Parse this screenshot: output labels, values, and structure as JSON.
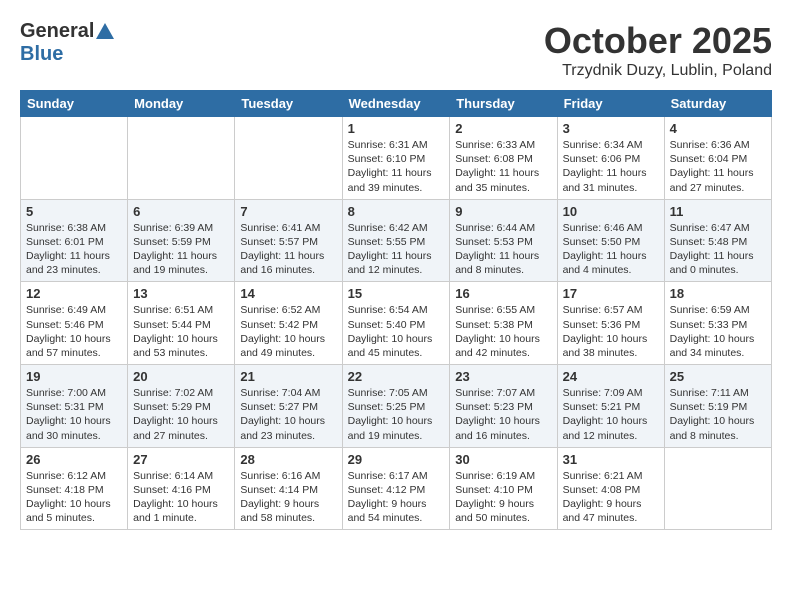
{
  "header": {
    "logo_general": "General",
    "logo_blue": "Blue",
    "month_title": "October 2025",
    "location": "Trzydnik Duzy, Lublin, Poland"
  },
  "days_of_week": [
    "Sunday",
    "Monday",
    "Tuesday",
    "Wednesday",
    "Thursday",
    "Friday",
    "Saturday"
  ],
  "weeks": [
    [
      {
        "day": "",
        "info": ""
      },
      {
        "day": "",
        "info": ""
      },
      {
        "day": "",
        "info": ""
      },
      {
        "day": "1",
        "info": "Sunrise: 6:31 AM\nSunset: 6:10 PM\nDaylight: 11 hours\nand 39 minutes."
      },
      {
        "day": "2",
        "info": "Sunrise: 6:33 AM\nSunset: 6:08 PM\nDaylight: 11 hours\nand 35 minutes."
      },
      {
        "day": "3",
        "info": "Sunrise: 6:34 AM\nSunset: 6:06 PM\nDaylight: 11 hours\nand 31 minutes."
      },
      {
        "day": "4",
        "info": "Sunrise: 6:36 AM\nSunset: 6:04 PM\nDaylight: 11 hours\nand 27 minutes."
      }
    ],
    [
      {
        "day": "5",
        "info": "Sunrise: 6:38 AM\nSunset: 6:01 PM\nDaylight: 11 hours\nand 23 minutes."
      },
      {
        "day": "6",
        "info": "Sunrise: 6:39 AM\nSunset: 5:59 PM\nDaylight: 11 hours\nand 19 minutes."
      },
      {
        "day": "7",
        "info": "Sunrise: 6:41 AM\nSunset: 5:57 PM\nDaylight: 11 hours\nand 16 minutes."
      },
      {
        "day": "8",
        "info": "Sunrise: 6:42 AM\nSunset: 5:55 PM\nDaylight: 11 hours\nand 12 minutes."
      },
      {
        "day": "9",
        "info": "Sunrise: 6:44 AM\nSunset: 5:53 PM\nDaylight: 11 hours\nand 8 minutes."
      },
      {
        "day": "10",
        "info": "Sunrise: 6:46 AM\nSunset: 5:50 PM\nDaylight: 11 hours\nand 4 minutes."
      },
      {
        "day": "11",
        "info": "Sunrise: 6:47 AM\nSunset: 5:48 PM\nDaylight: 11 hours\nand 0 minutes."
      }
    ],
    [
      {
        "day": "12",
        "info": "Sunrise: 6:49 AM\nSunset: 5:46 PM\nDaylight: 10 hours\nand 57 minutes."
      },
      {
        "day": "13",
        "info": "Sunrise: 6:51 AM\nSunset: 5:44 PM\nDaylight: 10 hours\nand 53 minutes."
      },
      {
        "day": "14",
        "info": "Sunrise: 6:52 AM\nSunset: 5:42 PM\nDaylight: 10 hours\nand 49 minutes."
      },
      {
        "day": "15",
        "info": "Sunrise: 6:54 AM\nSunset: 5:40 PM\nDaylight: 10 hours\nand 45 minutes."
      },
      {
        "day": "16",
        "info": "Sunrise: 6:55 AM\nSunset: 5:38 PM\nDaylight: 10 hours\nand 42 minutes."
      },
      {
        "day": "17",
        "info": "Sunrise: 6:57 AM\nSunset: 5:36 PM\nDaylight: 10 hours\nand 38 minutes."
      },
      {
        "day": "18",
        "info": "Sunrise: 6:59 AM\nSunset: 5:33 PM\nDaylight: 10 hours\nand 34 minutes."
      }
    ],
    [
      {
        "day": "19",
        "info": "Sunrise: 7:00 AM\nSunset: 5:31 PM\nDaylight: 10 hours\nand 30 minutes."
      },
      {
        "day": "20",
        "info": "Sunrise: 7:02 AM\nSunset: 5:29 PM\nDaylight: 10 hours\nand 27 minutes."
      },
      {
        "day": "21",
        "info": "Sunrise: 7:04 AM\nSunset: 5:27 PM\nDaylight: 10 hours\nand 23 minutes."
      },
      {
        "day": "22",
        "info": "Sunrise: 7:05 AM\nSunset: 5:25 PM\nDaylight: 10 hours\nand 19 minutes."
      },
      {
        "day": "23",
        "info": "Sunrise: 7:07 AM\nSunset: 5:23 PM\nDaylight: 10 hours\nand 16 minutes."
      },
      {
        "day": "24",
        "info": "Sunrise: 7:09 AM\nSunset: 5:21 PM\nDaylight: 10 hours\nand 12 minutes."
      },
      {
        "day": "25",
        "info": "Sunrise: 7:11 AM\nSunset: 5:19 PM\nDaylight: 10 hours\nand 8 minutes."
      }
    ],
    [
      {
        "day": "26",
        "info": "Sunrise: 6:12 AM\nSunset: 4:18 PM\nDaylight: 10 hours\nand 5 minutes."
      },
      {
        "day": "27",
        "info": "Sunrise: 6:14 AM\nSunset: 4:16 PM\nDaylight: 10 hours\nand 1 minute."
      },
      {
        "day": "28",
        "info": "Sunrise: 6:16 AM\nSunset: 4:14 PM\nDaylight: 9 hours\nand 58 minutes."
      },
      {
        "day": "29",
        "info": "Sunrise: 6:17 AM\nSunset: 4:12 PM\nDaylight: 9 hours\nand 54 minutes."
      },
      {
        "day": "30",
        "info": "Sunrise: 6:19 AM\nSunset: 4:10 PM\nDaylight: 9 hours\nand 50 minutes."
      },
      {
        "day": "31",
        "info": "Sunrise: 6:21 AM\nSunset: 4:08 PM\nDaylight: 9 hours\nand 47 minutes."
      },
      {
        "day": "",
        "info": ""
      }
    ]
  ]
}
